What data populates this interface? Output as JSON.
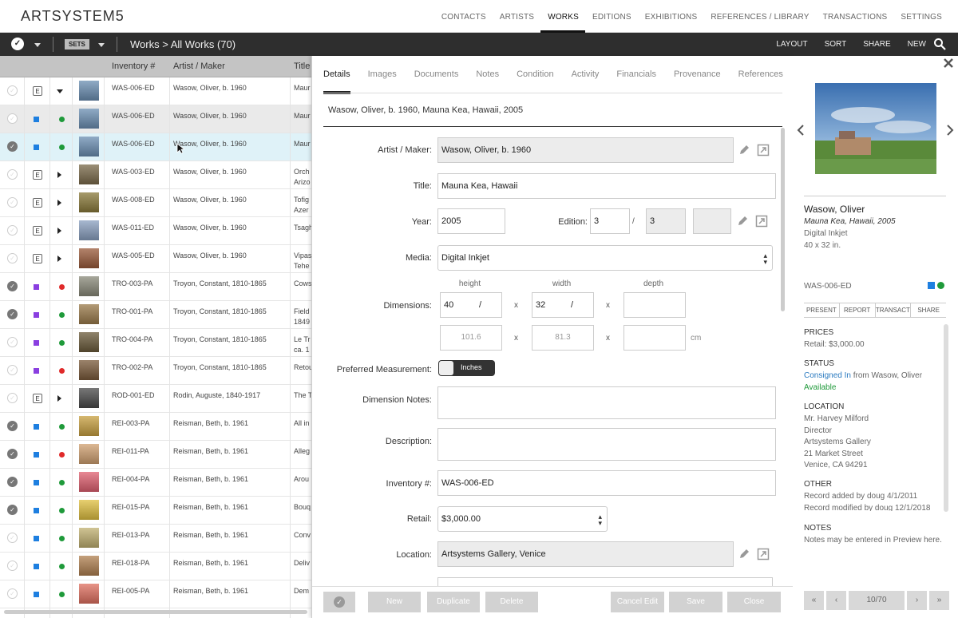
{
  "app": {
    "logo": "ARTSYSTEM5"
  },
  "nav": {
    "items": [
      "CONTACTS",
      "ARTISTS",
      "WORKS",
      "EDITIONS",
      "EXHIBITIONS",
      "REFERENCES / LIBRARY",
      "TRANSACTIONS",
      "SETTINGS"
    ],
    "active": "WORKS"
  },
  "toolbar": {
    "sets_label": "SETS",
    "breadcrumb": "Works > All Works (70)",
    "buttons": [
      "LAYOUT",
      "SORT",
      "SHARE",
      "NEW"
    ]
  },
  "grid": {
    "headers": {
      "inventory": "Inventory #",
      "artist": "Artist / Maker",
      "title": "Title"
    },
    "rows": [
      {
        "check": false,
        "kind": "E",
        "status": "",
        "expand": "down",
        "inv": "WAS-006-ED",
        "artist": "Wasow, Oliver, b. 1960",
        "title": "Maur",
        "title2": "",
        "thumb": "#6b8fb3"
      },
      {
        "check": false,
        "kind": "blue",
        "status": "green",
        "expand": "",
        "inv": "WAS-006-ED",
        "artist": "Wasow, Oliver, b. 1960",
        "title": "Maur",
        "title2": "",
        "thumb": "#6b8fb3"
      },
      {
        "check": true,
        "kind": "blue",
        "status": "green",
        "expand": "",
        "inv": "WAS-006-ED",
        "artist": "Wasow, Oliver, b. 1960",
        "title": "Maur",
        "title2": "",
        "thumb": "#6b8fb3"
      },
      {
        "check": false,
        "kind": "E",
        "status": "",
        "expand": "right",
        "inv": "WAS-003-ED",
        "artist": "Wasow, Oliver, b. 1960",
        "title": "Orch",
        "title2": "Arizo",
        "thumb": "#7a6a4a"
      },
      {
        "check": false,
        "kind": "E",
        "status": "",
        "expand": "right",
        "inv": "WAS-008-ED",
        "artist": "Wasow, Oliver, b. 1960",
        "title": "Tofig",
        "title2": "Azer",
        "thumb": "#8a7a3a"
      },
      {
        "check": false,
        "kind": "E",
        "status": "",
        "expand": "right",
        "inv": "WAS-011-ED",
        "artist": "Wasow, Oliver, b. 1960",
        "title": "Tsagh",
        "title2": "",
        "thumb": "#8aa0c0"
      },
      {
        "check": false,
        "kind": "E",
        "status": "",
        "expand": "right",
        "inv": "WAS-005-ED",
        "artist": "Wasow, Oliver, b. 1960",
        "title": "Vipas",
        "title2": "Tehe",
        "thumb": "#9a5a3a"
      },
      {
        "check": true,
        "kind": "purple",
        "status": "red",
        "expand": "",
        "inv": "TRO-003-PA",
        "artist": "Troyon, Constant, 1810-1865",
        "title": "Cows",
        "title2": "",
        "thumb": "#8a8a7a"
      },
      {
        "check": true,
        "kind": "purple",
        "status": "green",
        "expand": "",
        "inv": "TRO-001-PA",
        "artist": "Troyon, Constant, 1810-1865",
        "title": "Field",
        "title2": "1849",
        "thumb": "#9a7a4a"
      },
      {
        "check": false,
        "kind": "purple",
        "status": "green",
        "expand": "",
        "inv": "TRO-004-PA",
        "artist": "Troyon, Constant, 1810-1865",
        "title": "Le Tr",
        "title2": "ca. 1",
        "thumb": "#6a5a3a"
      },
      {
        "check": false,
        "kind": "purple",
        "status": "red",
        "expand": "",
        "inv": "TRO-002-PA",
        "artist": "Troyon, Constant, 1810-1865",
        "title": "Retou",
        "title2": "",
        "thumb": "#7a5a3a"
      },
      {
        "check": false,
        "kind": "E",
        "status": "",
        "expand": "right",
        "inv": "ROD-001-ED",
        "artist": "Rodin, Auguste, 1840-1917",
        "title": "The T",
        "title2": "",
        "thumb": "#4a4a4a"
      },
      {
        "check": true,
        "kind": "blue",
        "status": "green",
        "expand": "",
        "inv": "REI-003-PA",
        "artist": "Reisman, Beth, b. 1961",
        "title": "All in",
        "title2": "",
        "thumb": "#c8a040"
      },
      {
        "check": true,
        "kind": "blue",
        "status": "red",
        "expand": "",
        "inv": "REI-011-PA",
        "artist": "Reisman, Beth, b. 1961",
        "title": "Alleg",
        "title2": "",
        "thumb": "#d0a070"
      },
      {
        "check": true,
        "kind": "blue",
        "status": "green",
        "expand": "",
        "inv": "REI-004-PA",
        "artist": "Reisman, Beth, b. 1961",
        "title": "Arou",
        "title2": "",
        "thumb": "#e06070"
      },
      {
        "check": true,
        "kind": "blue",
        "status": "green",
        "expand": "",
        "inv": "REI-015-PA",
        "artist": "Reisman, Beth, b. 1961",
        "title": "Bouq",
        "title2": "",
        "thumb": "#e0c040"
      },
      {
        "check": false,
        "kind": "blue",
        "status": "green",
        "expand": "",
        "inv": "REI-013-PA",
        "artist": "Reisman, Beth, b. 1961",
        "title": "Conv",
        "title2": "",
        "thumb": "#c0b070"
      },
      {
        "check": false,
        "kind": "blue",
        "status": "green",
        "expand": "",
        "inv": "REI-018-PA",
        "artist": "Reisman, Beth, b. 1961",
        "title": "Deliv",
        "title2": "",
        "thumb": "#b08050"
      },
      {
        "check": false,
        "kind": "blue",
        "status": "green",
        "expand": "",
        "inv": "REI-005-PA",
        "artist": "Reisman, Beth, b. 1961",
        "title": "Dem",
        "title2": "",
        "thumb": "#e07060"
      }
    ]
  },
  "detail": {
    "tabs": [
      "Details",
      "Images",
      "Documents",
      "Notes",
      "Condition",
      "Activity",
      "Financials",
      "Provenance",
      "References"
    ],
    "record_title": "Wasow, Oliver, b. 1960, Mauna Kea, Hawaii, 2005",
    "labels": {
      "artist": "Artist / Maker:",
      "title": "Title:",
      "year": "Year:",
      "edition": "Edition:",
      "media": "Media:",
      "dimensions": "Dimensions:",
      "preferred": "Preferred Measurement:",
      "dim_notes": "Dimension Notes:",
      "description": "Description:",
      "inventory": "Inventory #:",
      "retail": "Retail:",
      "location": "Location:"
    },
    "values": {
      "artist": "Wasow, Oliver, b. 1960",
      "title": "Mauna Kea, Hawaii",
      "year": "2005",
      "edition_num": "3",
      "edition_slash": "/",
      "edition_total": "3",
      "media": "Digital Inkjet",
      "inventory": "WAS-006-ED",
      "retail": "$3,000.00",
      "location": "Artsystems Gallery, Venice"
    },
    "dims": {
      "height_label": "height",
      "width_label": "width",
      "depth_label": "depth",
      "height": "40",
      "width": "32",
      "slash": "/",
      "x": "x",
      "height_cm": "101.6",
      "width_cm": "81.3",
      "cm_unit": "cm",
      "toggle": "Inches"
    },
    "buttons": {
      "new": "New",
      "duplicate": "Duplicate",
      "delete": "Delete",
      "cancel": "Cancel Edit",
      "save": "Save",
      "close": "Close"
    }
  },
  "preview": {
    "artist": "Wasow, Oliver",
    "title": "Mauna Kea, Hawaii, 2005",
    "medium": "Digital Inkjet",
    "size": "40 x 32 in.",
    "inventory": "WAS-006-ED",
    "tabs": [
      "PRESENT",
      "REPORT",
      "TRANSACT",
      "SHARE"
    ],
    "prices_head": "PRICES",
    "retail": "Retail: $3,000.00",
    "status_head": "STATUS",
    "consigned": "Consigned In",
    "consigned_from": "from Wasow, Oliver",
    "available": "Available",
    "location_head": "LOCATION",
    "location_lines": [
      "Mr. Harvey Milford",
      "Director",
      "Artsystems Gallery",
      "21 Market Street",
      "Venice, CA 94291"
    ],
    "other_head": "OTHER",
    "other_lines": [
      "Record added by doug 4/1/2011",
      "Record modified by doug 12/1/2018"
    ],
    "notes_head": "NOTES",
    "notes": "Notes may be entered in Preview here.",
    "pager": "10/70"
  },
  "colors": {
    "blue": "#1e7fe0",
    "purple": "#8a3fe0",
    "green": "#1f9a3a",
    "red": "#e02a2a",
    "link": "#2a7ac0",
    "available": "#1f9a3a"
  }
}
